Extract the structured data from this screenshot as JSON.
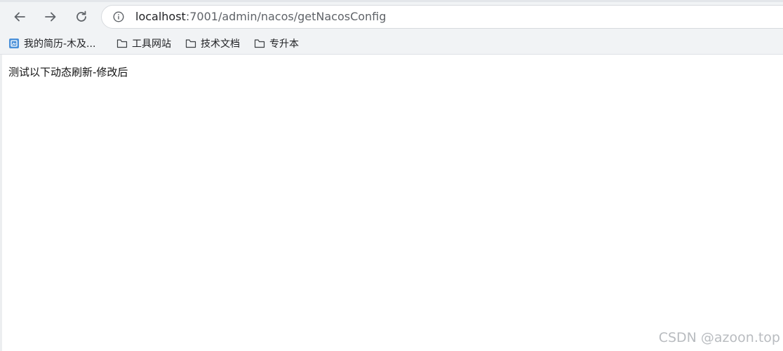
{
  "toolbar": {
    "back_icon": "arrow-left-icon",
    "forward_icon": "arrow-right-icon",
    "reload_icon": "reload-icon"
  },
  "omnibox": {
    "info_icon": "info-icon",
    "url_host": "localhost",
    "url_rest": ":7001/admin/nacos/getNacosConfig"
  },
  "bookmarks": [
    {
      "label": "我的简历-木及...",
      "icon": "site-favicon-icon"
    },
    {
      "label": "工具网站",
      "icon": "folder-icon"
    },
    {
      "label": "技术文档",
      "icon": "folder-icon"
    },
    {
      "label": "专升本",
      "icon": "folder-icon"
    }
  ],
  "page": {
    "text": "测试以下动态刷新-修改后"
  },
  "watermark": "CSDN @azoon.top",
  "colors": {
    "chrome_bg": "#f1f3f5",
    "favicon_blue": "#4a90d9"
  }
}
